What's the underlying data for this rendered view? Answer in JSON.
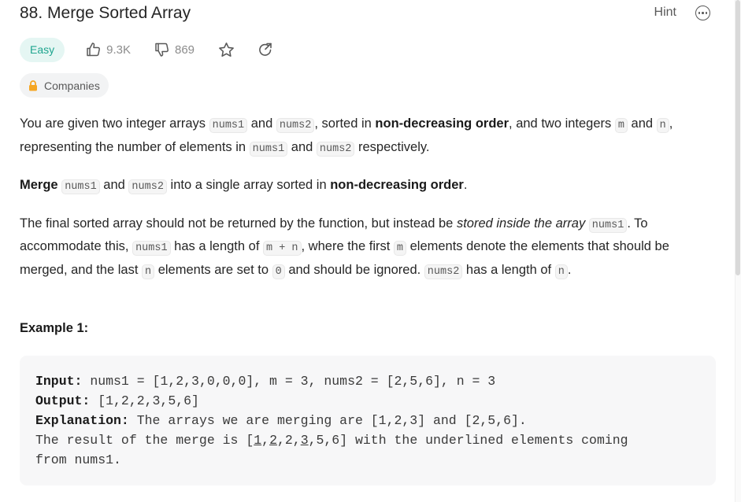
{
  "problem": {
    "title": "88. Merge Sorted Array",
    "hint_label": "Hint",
    "difficulty": "Easy",
    "likes": "9.3K",
    "dislikes": "869",
    "companies_label": "Companies"
  },
  "description": {
    "p1": {
      "t1": "You are given two integer arrays ",
      "c1": "nums1",
      "t2": " and ",
      "c2": "nums2",
      "t3": ", sorted in ",
      "b1": "non-decreasing order",
      "t4": ", and two integers ",
      "c3": "m",
      "t5": " and ",
      "c4": "n",
      "t6": ", representing the number of elements in ",
      "c5": "nums1",
      "t7": " and ",
      "c6": "nums2",
      "t8": " respectively."
    },
    "p2": {
      "b1": "Merge",
      "c1": "nums1",
      "t1": " and ",
      "c2": "nums2",
      "t2": " into a single array sorted in ",
      "b2": "non-decreasing order",
      "t3": "."
    },
    "p3": {
      "t1": "The final sorted array should not be returned by the function, but instead be ",
      "i1": "stored inside the array",
      "c1": "nums1",
      "t2": ". To accommodate this, ",
      "c2": "nums1",
      "t3": " has a length of ",
      "c3": "m + n",
      "t4": ", where the first ",
      "c4": "m",
      "t5": " elements denote the elements that should be merged, and the last ",
      "c5": "n",
      "t6": " elements are set to ",
      "c6": "0",
      "t7": " and should be ignored. ",
      "c7": "nums2",
      "t8": " has a length of ",
      "c8": "n",
      "t9": "."
    }
  },
  "example1": {
    "title": "Example 1:",
    "input_label": "Input:",
    "input_value": " nums1 = [1,2,3,0,0,0], m = 3, nums2 = [2,5,6], n = 3",
    "output_label": "Output:",
    "output_value": " [1,2,2,3,5,6]",
    "explanation_label": "Explanation:",
    "explanation_value": " The arrays we are merging are [1,2,3] and [2,5,6].",
    "result_prefix": "The result of the merge is [",
    "r1": "1",
    "r_sep1": ",",
    "r2": "2",
    "r_sep2": ",2,",
    "r3": "3",
    "r_suffix": ",5,6] with the underlined elements coming",
    "result_line2": "from nums1."
  },
  "colors": {
    "easy_text": "#1fa58f",
    "easy_bg": "#e5f6f3",
    "lock": "#f5a623"
  }
}
